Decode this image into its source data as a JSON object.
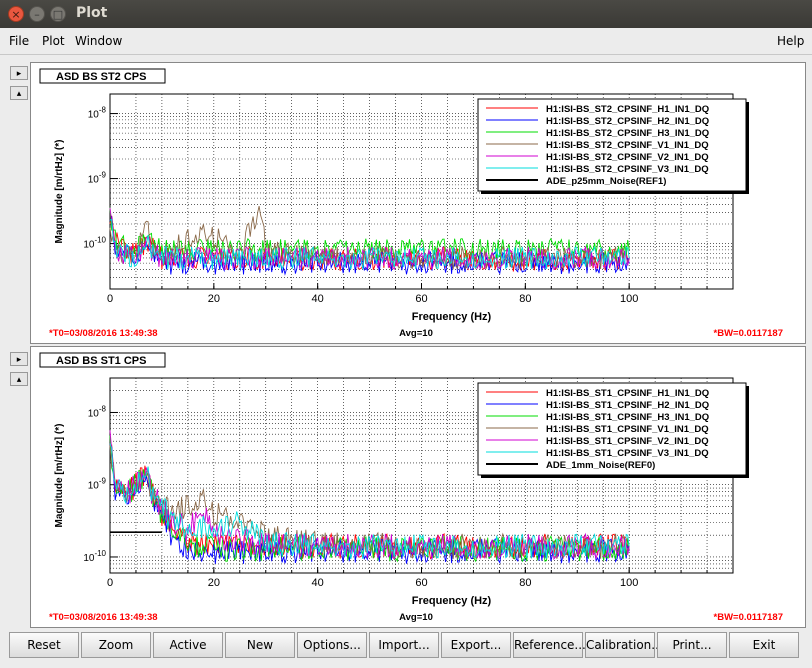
{
  "window": {
    "title": "Plot"
  },
  "menu": {
    "file": "File",
    "plot": "Plot",
    "window": "Window",
    "help": "Help"
  },
  "side_buttons": {
    "expand": "▸",
    "collapse": "▴"
  },
  "colors": {
    "red": "#ff0000",
    "blue": "#0000ff",
    "green": "#00dd00",
    "brown": "#8b6a4a",
    "magenta": "#d000d0",
    "cyan": "#00dddd",
    "black": "#000000"
  },
  "buttons": [
    "Reset",
    "Zoom",
    "Active",
    "New",
    "Options...",
    "Import...",
    "Export...",
    "Reference...",
    "Calibration...",
    "Print...",
    "Exit"
  ],
  "chart_data": [
    {
      "type": "line",
      "title": "ASD BS ST2 CPS",
      "xlabel": "Frequency (Hz)",
      "ylabel": "Magnitude [m/rtHz] (*)",
      "xlim": [
        0,
        120
      ],
      "ylim": [
        2e-11,
        2e-08
      ],
      "yscale": "log",
      "xticks": [
        "0",
        "20",
        "40",
        "60",
        "80",
        "100"
      ],
      "yticks": [
        "10^-10",
        "10^-9",
        "10^-8"
      ],
      "grid": true,
      "legend_position": "top-right",
      "footer_left": "*T0=03/08/2016 13:49:38",
      "footer_center": "Avg=10",
      "footer_right": "*BW=0.0117187",
      "series": [
        {
          "name": "H1:ISI-BS_ST2_CPSINF_H1_IN1_DQ",
          "color": "#ff0000",
          "x": [
            0,
            1,
            2,
            5,
            7,
            8,
            10,
            20,
            30,
            40,
            60,
            80,
            100
          ],
          "y": [
            3e-10,
            1.2e-10,
            8e-11,
            7e-11,
            1.1e-10,
            9e-11,
            6e-11,
            6e-11,
            6e-11,
            5.5e-11,
            6e-11,
            5.5e-11,
            5.5e-11
          ]
        },
        {
          "name": "H1:ISI-BS_ST2_CPSINF_H2_IN1_DQ",
          "color": "#0000ff",
          "x": [
            0,
            1,
            2,
            5,
            7,
            8,
            10,
            20,
            30,
            40,
            60,
            80,
            100
          ],
          "y": [
            2.5e-10,
            1e-10,
            7e-11,
            6e-11,
            1e-10,
            8e-11,
            5e-11,
            5e-11,
            5e-11,
            5e-11,
            5e-11,
            5e-11,
            5e-11
          ]
        },
        {
          "name": "H1:ISI-BS_ST2_CPSINF_H3_IN1_DQ",
          "color": "#00dd00",
          "x": [
            0,
            1,
            2,
            5,
            7,
            8,
            10,
            20,
            30,
            40,
            60,
            80,
            100
          ],
          "y": [
            3e-10,
            1.3e-10,
            9e-11,
            8e-11,
            1.3e-10,
            1e-10,
            8e-11,
            8e-11,
            8e-11,
            8e-11,
            8e-11,
            8e-11,
            8e-11
          ]
        },
        {
          "name": "H1:ISI-BS_ST2_CPSINF_V1_IN1_DQ",
          "color": "#8b6a4a",
          "x": [
            0,
            1,
            2,
            5,
            7,
            8,
            10,
            15,
            18,
            20,
            25,
            29,
            30,
            40,
            60,
            100
          ],
          "y": [
            2e-10,
            9e-11,
            7e-11,
            6e-11,
            2.5e-10,
            9e-11,
            6e-11,
            1.2e-10,
            1.6e-10,
            1.3e-10,
            7e-11,
            4e-10,
            8e-11,
            6e-11,
            6e-11,
            6e-11
          ]
        },
        {
          "name": "H1:ISI-BS_ST2_CPSINF_V2_IN1_DQ",
          "color": "#d000d0",
          "x": [
            0,
            1,
            2,
            5,
            7,
            8,
            10,
            20,
            30,
            40,
            60,
            80,
            100
          ],
          "y": [
            2.5e-10,
            1e-10,
            7e-11,
            6e-11,
            1.1e-10,
            8e-11,
            6e-11,
            6e-11,
            6e-11,
            6e-11,
            6e-11,
            6e-11,
            6e-11
          ]
        },
        {
          "name": "H1:ISI-BS_ST2_CPSINF_V3_IN1_DQ",
          "color": "#00dddd",
          "x": [
            0,
            1,
            2,
            5,
            7,
            8,
            10,
            20,
            30,
            40,
            60,
            80,
            100
          ],
          "y": [
            2.5e-10,
            1e-10,
            7e-11,
            6e-11,
            1e-10,
            8e-11,
            6e-11,
            6e-11,
            6e-11,
            6e-11,
            6e-11,
            6e-11,
            6e-11
          ]
        },
        {
          "name": "ADE_p25mm_Noise(REF1)",
          "color": "#000000",
          "x": [],
          "y": []
        }
      ]
    },
    {
      "type": "line",
      "title": "ASD BS ST1 CPS",
      "xlabel": "Frequency (Hz)",
      "ylabel": "Magnitude [m/rtHz] (*)",
      "xlim": [
        0,
        120
      ],
      "ylim": [
        6e-11,
        3e-08
      ],
      "yscale": "log",
      "xticks": [
        "0",
        "20",
        "40",
        "60",
        "80",
        "100"
      ],
      "yticks": [
        "10^-10",
        "10^-9",
        "10^-8"
      ],
      "grid": true,
      "legend_position": "top-right",
      "footer_left": "*T0=03/08/2016 13:49:38",
      "footer_center": "Avg=10",
      "footer_right": "*BW=0.0117187",
      "series": [
        {
          "name": "H1:ISI-BS_ST1_CPSINF_H1_IN1_DQ",
          "color": "#ff0000",
          "x": [
            0,
            1,
            3,
            5,
            7,
            8,
            10,
            12,
            15,
            20,
            25,
            30,
            40,
            60,
            80,
            100
          ],
          "y": [
            5e-09,
            1e-09,
            7e-10,
            1e-09,
            1.6e-09,
            8e-10,
            4e-10,
            2.5e-10,
            1.6e-10,
            1.4e-10,
            1.4e-10,
            1.4e-10,
            1.4e-10,
            1.4e-10,
            1.4e-10,
            1.4e-10
          ]
        },
        {
          "name": "H1:ISI-BS_ST1_CPSINF_H2_IN1_DQ",
          "color": "#0000ff",
          "x": [
            0,
            1,
            3,
            5,
            7,
            8,
            10,
            12,
            15,
            20,
            30,
            40,
            60,
            80,
            100
          ],
          "y": [
            4e-09,
            9e-10,
            6e-10,
            9e-10,
            1.3e-09,
            7e-10,
            3.5e-10,
            2e-10,
            1.3e-10,
            1.2e-10,
            1.2e-10,
            1.2e-10,
            1.2e-10,
            1.2e-10,
            1.2e-10
          ]
        },
        {
          "name": "H1:ISI-BS_ST1_CPSINF_H3_IN1_DQ",
          "color": "#00dd00",
          "x": [
            0,
            1,
            3,
            5,
            7,
            8,
            10,
            12,
            15,
            20,
            30,
            40,
            60,
            80,
            100
          ],
          "y": [
            4e-09,
            9e-10,
            7e-10,
            1e-09,
            1.5e-09,
            8e-10,
            4e-10,
            2.5e-10,
            1.5e-10,
            1.3e-10,
            1.3e-10,
            1.3e-10,
            1.3e-10,
            1.3e-10,
            1.3e-10
          ]
        },
        {
          "name": "H1:ISI-BS_ST1_CPSINF_V1_IN1_DQ",
          "color": "#8b6a4a",
          "x": [
            0,
            1,
            3,
            5,
            7,
            8,
            10,
            12,
            15,
            18,
            20,
            25,
            30,
            40,
            60,
            100
          ],
          "y": [
            4e-09,
            1e-09,
            7e-10,
            1e-09,
            1.5e-09,
            8e-10,
            5e-10,
            4e-10,
            5e-10,
            7e-10,
            4e-10,
            3e-10,
            2e-10,
            1.5e-10,
            1.4e-10,
            1.4e-10
          ]
        },
        {
          "name": "H1:ISI-BS_ST1_CPSINF_V2_IN1_DQ",
          "color": "#d000d0",
          "x": [
            0,
            1,
            3,
            5,
            7,
            8,
            10,
            12,
            15,
            18,
            20,
            30,
            40,
            60,
            100
          ],
          "y": [
            4e-09,
            1e-09,
            7e-10,
            1e-09,
            1.5e-09,
            8e-10,
            5e-10,
            3e-10,
            2.5e-10,
            4e-10,
            2e-10,
            1.5e-10,
            1.4e-10,
            1.4e-10,
            1.4e-10
          ]
        },
        {
          "name": "H1:ISI-BS_ST1_CPSINF_V3_IN1_DQ",
          "color": "#00dddd",
          "x": [
            0,
            1,
            3,
            5,
            7,
            8,
            10,
            12,
            15,
            20,
            25,
            30,
            40,
            60,
            100
          ],
          "y": [
            4e-09,
            1e-09,
            7e-10,
            1e-09,
            1.5e-09,
            8e-10,
            5e-10,
            3e-10,
            2.5e-10,
            2.5e-10,
            3e-10,
            1.6e-10,
            1.4e-10,
            1.4e-10,
            1.4e-10
          ]
        },
        {
          "name": "ADE_1mm_Noise(REF0)",
          "color": "#000000",
          "x": [
            0,
            10
          ],
          "y": [
            2.2e-10,
            2.2e-10
          ]
        }
      ]
    }
  ]
}
